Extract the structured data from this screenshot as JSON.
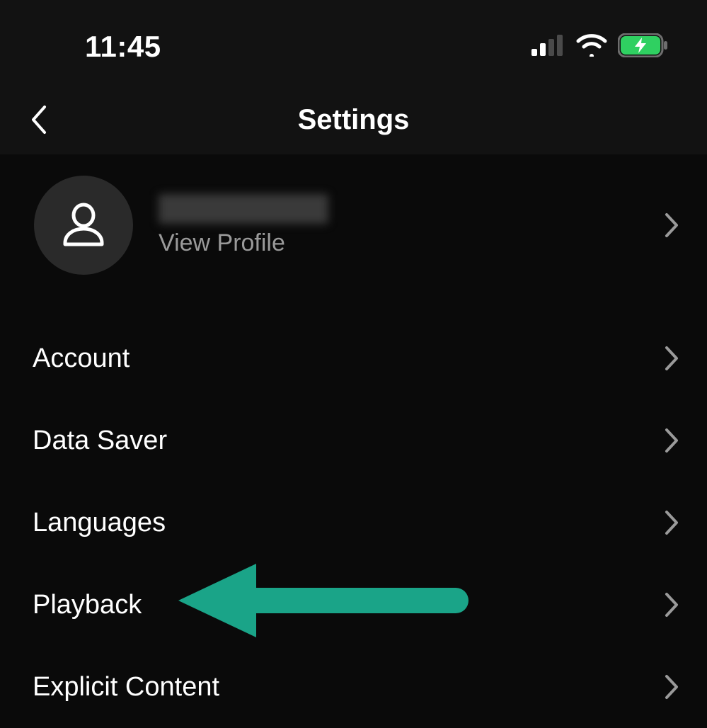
{
  "status": {
    "time": "11:45"
  },
  "nav": {
    "title": "Settings"
  },
  "profile": {
    "subtitle": "View Profile"
  },
  "settings": {
    "items": [
      {
        "label": "Account"
      },
      {
        "label": "Data Saver"
      },
      {
        "label": "Languages"
      },
      {
        "label": "Playback"
      },
      {
        "label": "Explicit Content"
      }
    ]
  },
  "annotation": {
    "color": "#1aa488"
  }
}
